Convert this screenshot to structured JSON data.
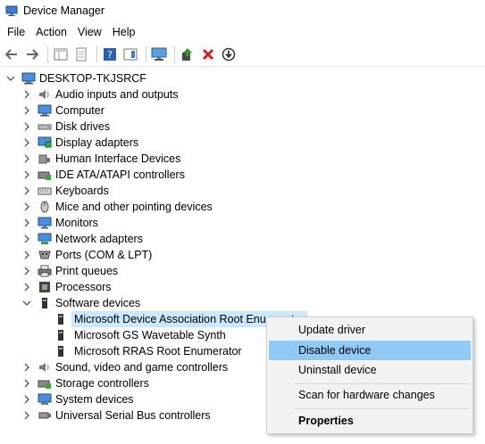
{
  "window": {
    "title": "Device Manager"
  },
  "menu": [
    "File",
    "Action",
    "View",
    "Help"
  ],
  "toolbar": {
    "icons": [
      "back-icon",
      "forward-icon",
      "properties-sheet-icon",
      "page-icon",
      "help-icon",
      "panel-icon",
      "monitor-scan-icon",
      "update-driver-icon",
      "uninstall-icon",
      "disable-icon"
    ]
  },
  "tree": {
    "root": "DESKTOP-TKJSRCF",
    "categories": [
      "Audio inputs and outputs",
      "Computer",
      "Disk drives",
      "Display adapters",
      "Human Interface Devices",
      "IDE ATA/ATAPI controllers",
      "Keyboards",
      "Mice and other pointing devices",
      "Monitors",
      "Network adapters",
      "Ports (COM & LPT)",
      "Print queues",
      "Processors",
      "Software devices"
    ],
    "software_children": [
      "Microsoft Device Association Root Enumerator",
      "Microsoft GS Wavetable Synth",
      "Microsoft RRAS Root Enumerator"
    ],
    "after": [
      "Sound, video and game controllers",
      "Storage controllers",
      "System devices",
      "Universal Serial Bus controllers"
    ]
  },
  "context_menu": {
    "items": [
      "Update driver",
      "Disable device",
      "Uninstall device",
      "Scan for hardware changes",
      "Properties"
    ],
    "highlighted": "Disable device"
  }
}
